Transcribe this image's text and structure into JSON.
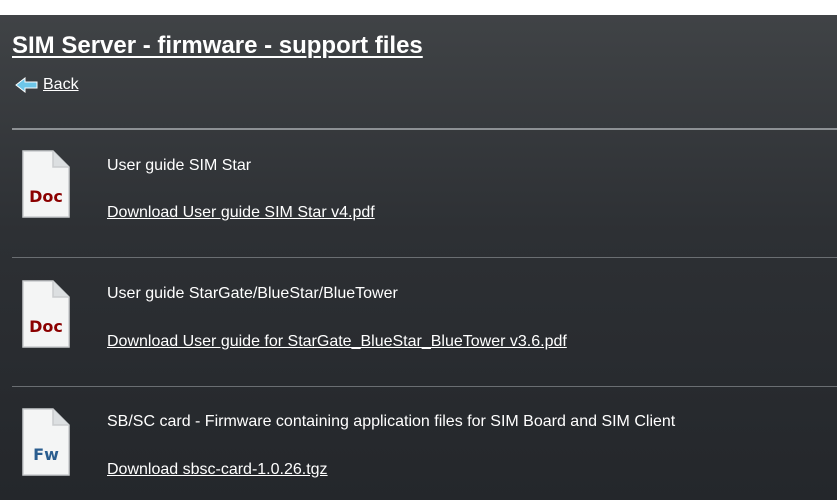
{
  "page": {
    "title": "SIM Server - firmware - support files",
    "back_label": "Back"
  },
  "items": [
    {
      "icon_name": "doc-file-icon",
      "icon_text": "Doc",
      "icon_text_color": "#8b0000",
      "title": "User guide SIM Star",
      "link": "Download User guide SIM Star v4.pdf"
    },
    {
      "icon_name": "doc-file-icon",
      "icon_text": "Doc",
      "icon_text_color": "#8b0000",
      "title": "User guide StarGate/BlueStar/BlueTower",
      "link": "Download User guide for StarGate_BlueStar_BlueTower v3.6.pdf"
    },
    {
      "icon_name": "firmware-file-icon",
      "icon_text": "Fw",
      "icon_text_color": "#2a5d8f",
      "title": "SB/SC card - Firmware containing application files for SIM Board and SIM Client",
      "link": "Download sbsc-card-1.0.26.tgz"
    }
  ],
  "colors": {
    "panel_background": "#2d3034",
    "text": "#ffffff",
    "back_arrow": "#6ec6e8"
  }
}
